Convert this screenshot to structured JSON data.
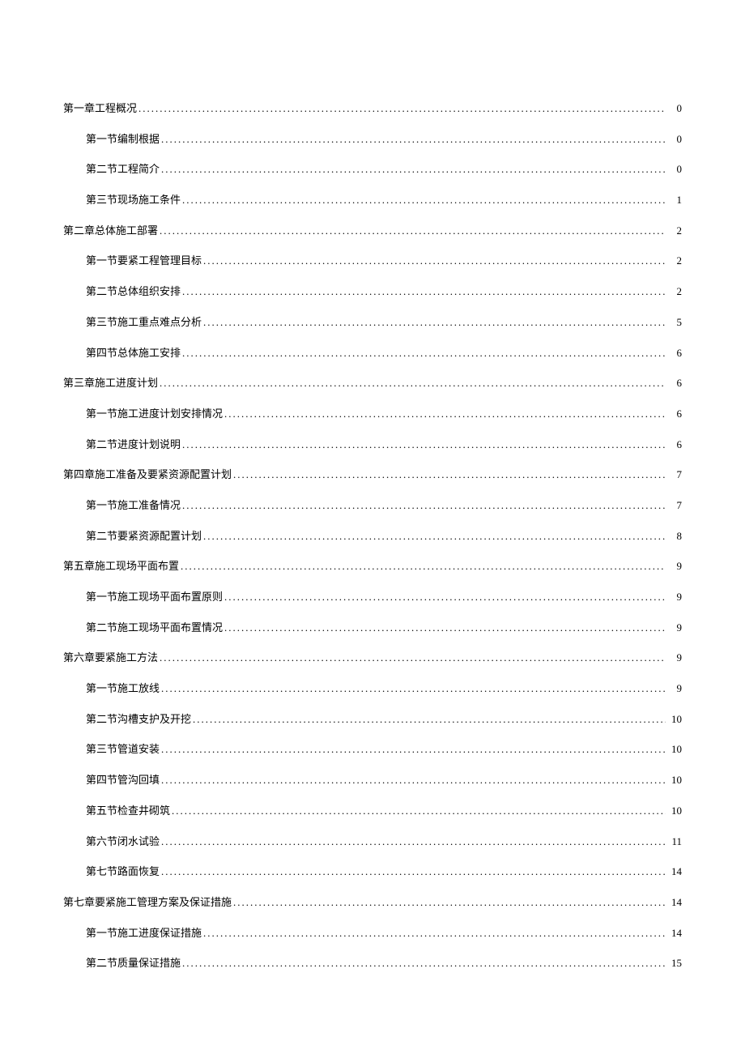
{
  "toc": [
    {
      "level": 1,
      "title": "第一章工程概况",
      "page": "0"
    },
    {
      "level": 2,
      "title": "第一节编制根据",
      "page": "0"
    },
    {
      "level": 2,
      "title": "第二节工程简介",
      "page": "0"
    },
    {
      "level": 2,
      "title": "第三节现场施工条件",
      "page": "1"
    },
    {
      "level": 1,
      "title": "第二章总体施工部署",
      "page": "2"
    },
    {
      "level": 2,
      "title": "第一节要紧工程管理目标",
      "page": "2"
    },
    {
      "level": 2,
      "title": "第二节总体组织安排",
      "page": "2"
    },
    {
      "level": 2,
      "title": "第三节施工重点难点分析",
      "page": "5"
    },
    {
      "level": 2,
      "title": "第四节总体施工安排",
      "page": "6"
    },
    {
      "level": 1,
      "title": "第三章施工进度计划",
      "page": "6"
    },
    {
      "level": 2,
      "title": "第一节施工进度计划安排情况",
      "page": "6"
    },
    {
      "level": 2,
      "title": "第二节进度计划说明",
      "page": "6"
    },
    {
      "level": 1,
      "title": "第四章施工准备及要紧资源配置计划",
      "page": "7"
    },
    {
      "level": 2,
      "title": "第一节施工准备情况",
      "page": "7"
    },
    {
      "level": 2,
      "title": "第二节要紧资源配置计划",
      "page": "8"
    },
    {
      "level": 1,
      "title": "第五章施工现场平面布置",
      "page": "9"
    },
    {
      "level": 2,
      "title": "第一节施工现场平面布置原则",
      "page": "9"
    },
    {
      "level": 2,
      "title": "第二节施工现场平面布置情况",
      "page": "9"
    },
    {
      "level": 1,
      "title": "第六章要紧施工方法",
      "page": "9"
    },
    {
      "level": 2,
      "title": "第一节施工放线",
      "page": "9"
    },
    {
      "level": 2,
      "title": "第二节沟槽支护及开挖",
      "page": "10"
    },
    {
      "level": 2,
      "title": "第三节管道安装",
      "page": "10"
    },
    {
      "level": 2,
      "title": "第四节管沟回填",
      "page": "10"
    },
    {
      "level": 2,
      "title": "第五节检查井砌筑",
      "page": "10"
    },
    {
      "level": 2,
      "title": "第六节闭水试验",
      "page": "11"
    },
    {
      "level": 2,
      "title": "第七节路面恢复",
      "page": "14"
    },
    {
      "level": 1,
      "title": "第七章要紧施工管理方案及保证措施",
      "page": "14"
    },
    {
      "level": 2,
      "title": "第一节施工进度保证措施",
      "page": "14"
    },
    {
      "level": 2,
      "title": "第二节质量保证措施",
      "page": "15"
    }
  ]
}
